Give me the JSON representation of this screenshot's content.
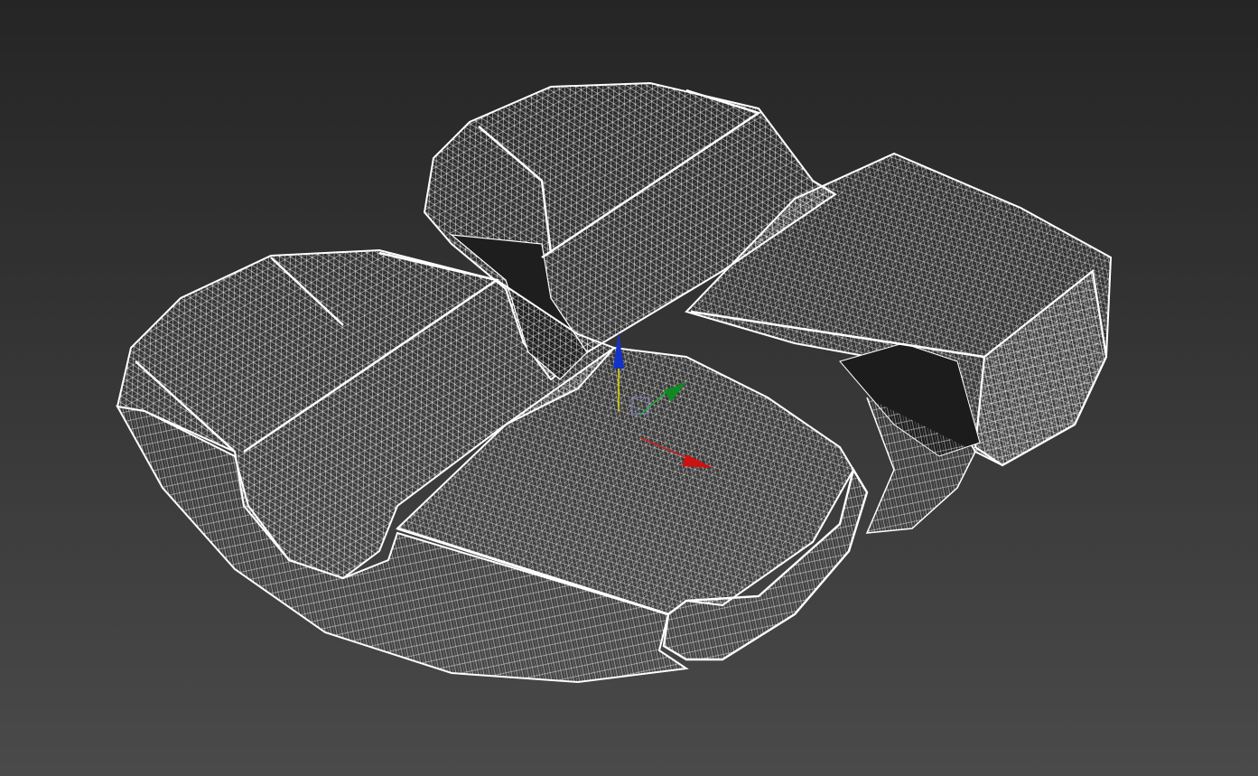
{
  "viewport": {
    "mode": "wireframe",
    "background_top": "#252525",
    "background_bottom": "#4a4a4a",
    "wire_color": "#ffffff"
  },
  "model": {
    "description_icon": "cushion-mesh-icon",
    "sections": 4
  },
  "gizmo": {
    "icon": "transform-gizmo-icon",
    "axes": [
      {
        "axis": "x",
        "color": "#cc1111"
      },
      {
        "axis": "y",
        "color": "#118822"
      },
      {
        "axis": "z",
        "color": "#1122cc"
      }
    ]
  }
}
